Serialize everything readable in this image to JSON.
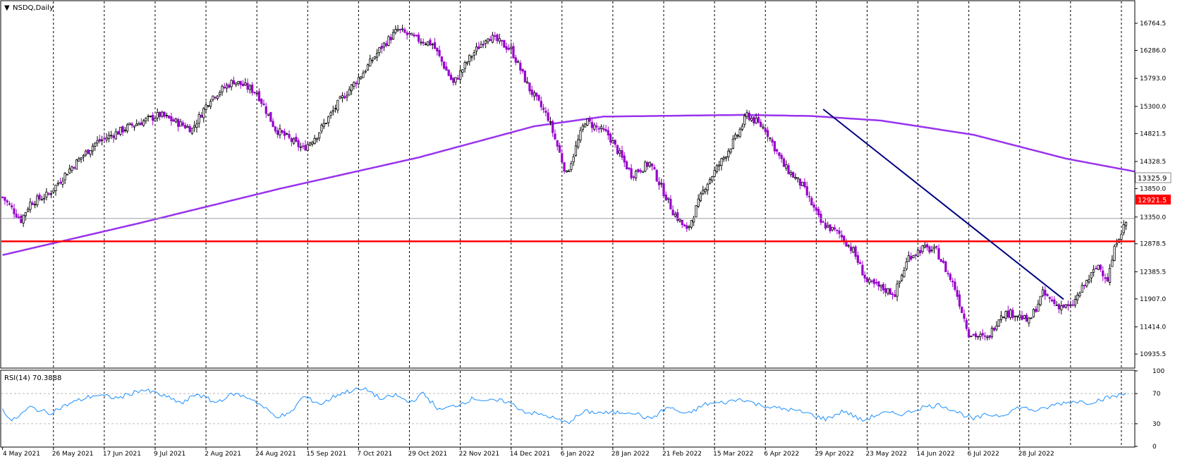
{
  "chart_data": [
    {
      "type": "candlestick",
      "title": "NSDQ,Daily",
      "title_marker": "▼",
      "ylim": [
        10700,
        17150
      ],
      "yticks": [
        10935.5,
        11414.0,
        11907.0,
        12385.5,
        12878.5,
        13350.0,
        13850.0,
        14328.5,
        14821.5,
        15300.0,
        15793.0,
        16286.0,
        16764.5
      ],
      "ytick_labels": [
        "10935.5",
        "11414.0",
        "11907.0",
        "12385.5",
        "12878.5",
        "13350.0",
        "13850.0",
        "14328.5",
        "14821.5",
        "15300.0",
        "15793.0",
        "16286.0",
        "16764.5"
      ],
      "x_labels": [
        "4 May 2021",
        "26 May 2021",
        "17 Jun 2021",
        "9 Jul 2021",
        "2 Aug 2021",
        "24 Aug 2021",
        "15 Sep 2021",
        "7 Oct 2021",
        "29 Oct 2021",
        "22 Nov 2021",
        "14 Dec 2021",
        "6 Jan 2022",
        "28 Jan 2022",
        "21 Feb 2022",
        "15 Mar 2022",
        "6 Apr 2022",
        "29 Apr 2022",
        "23 May 2022",
        "14 Jun 2022",
        "6 Jul 2022",
        "28 Jul 2022"
      ],
      "close_anchors": [
        [
          0,
          13700
        ],
        [
          5,
          13450
        ],
        [
          8,
          13300
        ],
        [
          12,
          13600
        ],
        [
          20,
          13750
        ],
        [
          28,
          14150
        ],
        [
          40,
          14650
        ],
        [
          55,
          14950
        ],
        [
          68,
          15150
        ],
        [
          82,
          14900
        ],
        [
          90,
          15450
        ],
        [
          100,
          15750
        ],
        [
          110,
          15550
        ],
        [
          118,
          14900
        ],
        [
          130,
          14550
        ],
        [
          136,
          14800
        ],
        [
          146,
          15400
        ],
        [
          156,
          15900
        ],
        [
          164,
          16350
        ],
        [
          171,
          16650
        ],
        [
          178,
          16500
        ],
        [
          186,
          16400
        ],
        [
          195,
          15700
        ],
        [
          202,
          16150
        ],
        [
          210,
          16550
        ],
        [
          220,
          16300
        ],
        [
          228,
          15600
        ],
        [
          236,
          15100
        ],
        [
          244,
          14100
        ],
        [
          252,
          15050
        ],
        [
          262,
          14800
        ],
        [
          272,
          14100
        ],
        [
          280,
          14300
        ],
        [
          290,
          13450
        ],
        [
          296,
          13100
        ],
        [
          304,
          13900
        ],
        [
          312,
          14400
        ],
        [
          318,
          14800
        ],
        [
          322,
          15150
        ],
        [
          330,
          14900
        ],
        [
          338,
          14250
        ],
        [
          346,
          13900
        ],
        [
          354,
          13250
        ],
        [
          362,
          13050
        ],
        [
          368,
          12750
        ],
        [
          374,
          12200
        ],
        [
          380,
          12100
        ],
        [
          386,
          12000
        ],
        [
          392,
          12650
        ],
        [
          398,
          12800
        ],
        [
          404,
          12750
        ],
        [
          412,
          12100
        ],
        [
          418,
          11300
        ],
        [
          426,
          11200
        ],
        [
          432,
          11650
        ],
        [
          438,
          11650
        ],
        [
          444,
          11500
        ],
        [
          450,
          12000
        ],
        [
          456,
          11800
        ],
        [
          462,
          11750
        ],
        [
          468,
          12150
        ],
        [
          474,
          12500
        ],
        [
          478,
          12250
        ],
        [
          482,
          12950
        ],
        [
          486,
          13250
        ]
      ],
      "series": [
        {
          "name": "MA",
          "color": "#9933ee",
          "anchors": [
            [
              0,
              12680
            ],
            [
              60,
              13250
            ],
            [
              120,
              13850
            ],
            [
              180,
              14400
            ],
            [
              230,
              14950
            ],
            [
              260,
              15120
            ],
            [
              320,
              15150
            ],
            [
              350,
              15130
            ],
            [
              380,
              15050
            ],
            [
              420,
              14800
            ],
            [
              460,
              14380
            ],
            [
              490,
              14150
            ]
          ]
        }
      ],
      "current_price": "13325.9",
      "current_value": 13325.9,
      "level_label": "12921.5",
      "level_value": 12921.5,
      "level_color": "#ff0000",
      "trendline": {
        "color": "#000080",
        "from": [
          355,
          15250
        ],
        "to": [
          459,
          11900
        ]
      },
      "up_color": "#000000",
      "down_color": "#9900cc"
    },
    {
      "type": "line",
      "title": "RSI(14) 70.3888",
      "ylim": [
        0,
        100
      ],
      "yticks": [
        0,
        30,
        70,
        100
      ],
      "ytick_labels": [
        "0",
        "30",
        "70",
        "100"
      ],
      "levels": [
        30,
        70
      ],
      "series": [
        {
          "name": "RSI(14)",
          "color": "#1e90ff",
          "anchors": [
            [
              0,
              50
            ],
            [
              4,
              33
            ],
            [
              12,
              52
            ],
            [
              20,
              44
            ],
            [
              30,
              58
            ],
            [
              40,
              68
            ],
            [
              50,
              64
            ],
            [
              60,
              75
            ],
            [
              66,
              71
            ],
            [
              78,
              57
            ],
            [
              84,
              70
            ],
            [
              92,
              58
            ],
            [
              100,
              70
            ],
            [
              108,
              63
            ],
            [
              118,
              40
            ],
            [
              124,
              42
            ],
            [
              130,
              66
            ],
            [
              138,
              56
            ],
            [
              145,
              69
            ],
            [
              152,
              75
            ],
            [
              158,
              75
            ],
            [
              164,
              62
            ],
            [
              170,
              68
            ],
            [
              176,
              58
            ],
            [
              182,
              70
            ],
            [
              189,
              48
            ],
            [
              196,
              54
            ],
            [
              204,
              64
            ],
            [
              210,
              60
            ],
            [
              218,
              60
            ],
            [
              226,
              46
            ],
            [
              236,
              40
            ],
            [
              244,
              31
            ],
            [
              252,
              46
            ],
            [
              262,
              44
            ],
            [
              272,
              46
            ],
            [
              280,
              36
            ],
            [
              288,
              52
            ],
            [
              296,
              42
            ],
            [
              304,
              56
            ],
            [
              312,
              58
            ],
            [
              320,
              63
            ],
            [
              326,
              56
            ],
            [
              334,
              51
            ],
            [
              340,
              49
            ],
            [
              348,
              44
            ],
            [
              356,
              36
            ],
            [
              364,
              47
            ],
            [
              372,
              34
            ],
            [
              380,
              44
            ],
            [
              390,
              43
            ],
            [
              398,
              52
            ],
            [
              406,
              55
            ],
            [
              412,
              47
            ],
            [
              420,
              36
            ],
            [
              426,
              42
            ],
            [
              432,
              41
            ],
            [
              440,
              52
            ],
            [
              448,
              47
            ],
            [
              456,
              56
            ],
            [
              464,
              60
            ],
            [
              470,
              58
            ],
            [
              476,
              63
            ],
            [
              482,
              67
            ],
            [
              486,
              70
            ]
          ]
        }
      ],
      "current_value": 70.3888
    }
  ]
}
